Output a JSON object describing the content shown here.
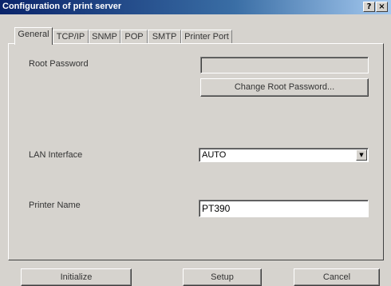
{
  "window": {
    "title": "Configuration of print server",
    "help_label": "?",
    "close_label": "×"
  },
  "tabs": [
    {
      "label": "General",
      "active": true
    },
    {
      "label": "TCP/IP",
      "active": false
    },
    {
      "label": "SNMP",
      "active": false
    },
    {
      "label": "POP",
      "active": false
    },
    {
      "label": "SMTP",
      "active": false
    },
    {
      "label": "Printer Port",
      "active": false
    }
  ],
  "general": {
    "root_password": {
      "label": "Root Password",
      "value": "",
      "enabled": false,
      "change_button": "Change Root Password..."
    },
    "lan_interface": {
      "label": "LAN Interface",
      "value": "AUTO",
      "arrow_icon": "dropdown-arrow-icon"
    },
    "printer_name": {
      "label": "Printer Name",
      "value": "PT390"
    }
  },
  "footer": {
    "initialize": "Initialize",
    "setup": "Setup",
    "cancel": "Cancel"
  }
}
